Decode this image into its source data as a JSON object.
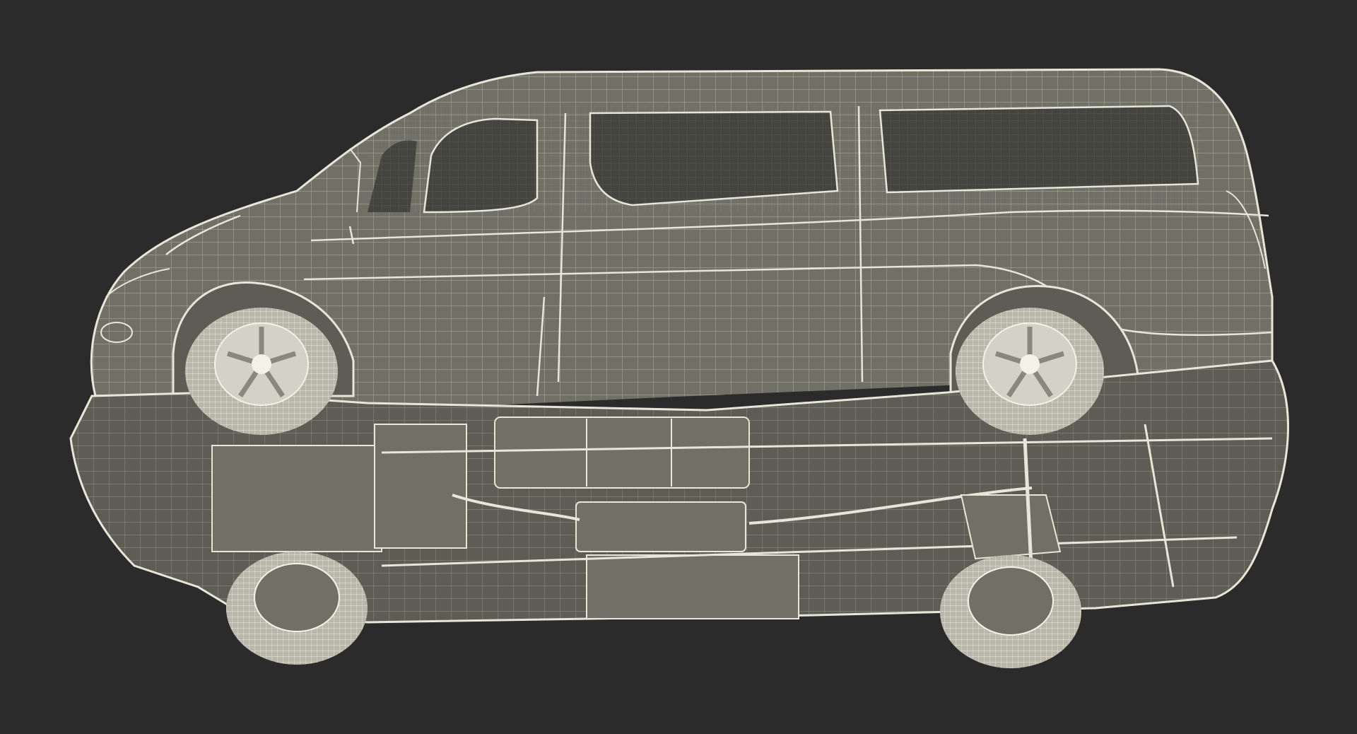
{
  "scene": {
    "subject": "wireframe-van-underside",
    "colors": {
      "background": "#2b2b2b",
      "body": "#707067",
      "body_dark": "#5d5d55",
      "body_light": "#86867c",
      "glass": "#45453f",
      "wire": "#e8e6d8",
      "tire": "#b9b7aa",
      "rim": "#d4d2c6",
      "shadow": "#3c3c36"
    }
  }
}
